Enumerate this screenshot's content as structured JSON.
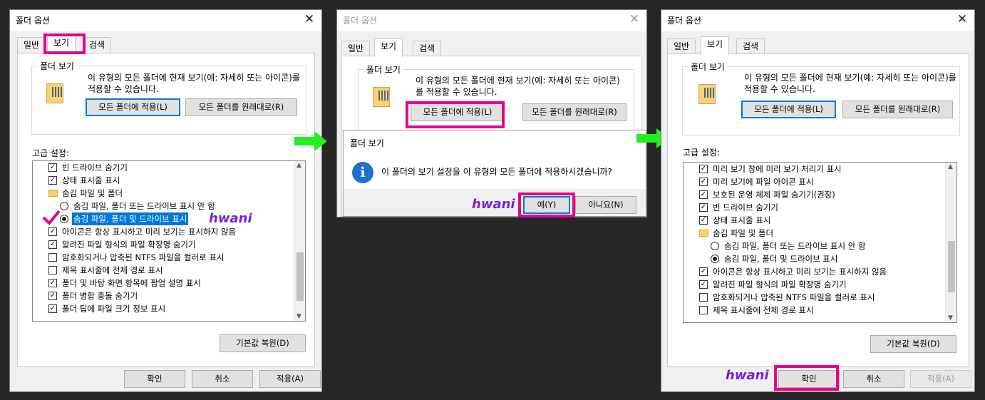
{
  "watermark": "hwani",
  "d1": {
    "title": "폴더 옵션",
    "tabs": [
      "일반",
      "보기",
      "검색"
    ],
    "group_label": "폴더 보기",
    "group_text": "이 유형의 모든 폴더에 현재 보기(예: 자세히 또는 아이콘)를 적용할 수 있습니다.",
    "apply_all": "모든 폴더에 적용(L)",
    "reset_all": "모든 폴더를 원래대로(R)",
    "adv_label": "고급 설정:",
    "items": [
      {
        "type": "check",
        "checked": true,
        "label": "빈 드라이브 숨기기",
        "indent": 0
      },
      {
        "type": "check",
        "checked": true,
        "label": "상태 표시줄 표시",
        "indent": 0
      },
      {
        "type": "folder",
        "label": "숨김 파일 및 폴더",
        "indent": 0
      },
      {
        "type": "radio",
        "checked": false,
        "label": "숨김 파일, 폴더 또는 드라이브 표시 안 함",
        "indent": 1
      },
      {
        "type": "radio",
        "checked": true,
        "label": "숨김 파일, 폴더 및 드라이브 표시",
        "indent": 1,
        "selected": true
      },
      {
        "type": "check",
        "checked": true,
        "label": "아이콘은 항상 표시하고 미리 보기는 표시하지 않음",
        "indent": 0
      },
      {
        "type": "check",
        "checked": true,
        "label": "알려진 파일 형식의 파일 확장명 숨기기",
        "indent": 0
      },
      {
        "type": "check",
        "checked": false,
        "label": "암호화되거나 압축된 NTFS 파일을 컬러로 표시",
        "indent": 0
      },
      {
        "type": "check",
        "checked": false,
        "label": "제목 표시줄에 전체 경로 표시",
        "indent": 0
      },
      {
        "type": "check",
        "checked": true,
        "label": "폴더 및 바탕 화면 항목에 팝업 설명 표시",
        "indent": 0
      },
      {
        "type": "check",
        "checked": true,
        "label": "폴더 병합 충돌 숨기기",
        "indent": 0
      },
      {
        "type": "check",
        "checked": true,
        "label": "폴더 팁에 파일 크기 정보 표시",
        "indent": 0
      }
    ],
    "restore": "기본값 복원(D)",
    "ok": "확인",
    "cancel": "취소",
    "apply": "적용(A)"
  },
  "d2": {
    "title": "폴더 옵션",
    "tabs": [
      "일반",
      "보기",
      "검색"
    ],
    "group_label": "폴더 보기",
    "group_text": "이 유형의 모든 폴더에 현재 보기(예: 자세히 또는 아이콘)를 적용할 수 있습니다.",
    "apply_all": "모든 폴더에 적용(L)",
    "reset_all": "모든 폴더를 원래대로(R)",
    "msg_title": "폴더 보기",
    "msg_text": "이 폴더의 보기 설정을 이 유형의 모든 폴더에 적용하시겠습니까?",
    "yes": "예(Y)",
    "no": "아니요(N)"
  },
  "d3": {
    "title": "폴더 옵션",
    "tabs": [
      "일반",
      "보기",
      "검색"
    ],
    "group_label": "폴더 보기",
    "group_text": "이 유형의 모든 폴더에 현재 보기(예: 자세히 또는 아이콘)를 적용할 수 있습니다.",
    "apply_all": "모든 폴더에 적용(L)",
    "reset_all": "모든 폴더를 원래대로(R)",
    "adv_label": "고급 설정:",
    "items": [
      {
        "type": "check",
        "checked": true,
        "label": "미리 보기 창에 미리 보기 처리기 표시",
        "indent": 0
      },
      {
        "type": "check",
        "checked": true,
        "label": "미리 보기에 파일 아이콘 표시",
        "indent": 0
      },
      {
        "type": "check",
        "checked": true,
        "label": "보호된 운영 체제 파일 숨기기(권장)",
        "indent": 0
      },
      {
        "type": "check",
        "checked": true,
        "label": "빈 드라이브 숨기기",
        "indent": 0
      },
      {
        "type": "check",
        "checked": true,
        "label": "상태 표시줄 표시",
        "indent": 0
      },
      {
        "type": "folder",
        "label": "숨김 파일 및 폴더",
        "indent": 0
      },
      {
        "type": "radio",
        "checked": false,
        "label": "숨김 파일, 폴더 또는 드라이브 표시 안 함",
        "indent": 1
      },
      {
        "type": "radio",
        "checked": true,
        "label": "숨김 파일, 폴더 및 드라이브 표시",
        "indent": 1
      },
      {
        "type": "check",
        "checked": true,
        "label": "아이콘은 항상 표시하고 미리 보기는 표시하지 않음",
        "indent": 0
      },
      {
        "type": "check",
        "checked": true,
        "label": "알려진 파일 형식의 파일 확장명 숨기기",
        "indent": 0
      },
      {
        "type": "check",
        "checked": false,
        "label": "암호화되거나 압축된 NTFS 파일을 컬러로 표시",
        "indent": 0
      },
      {
        "type": "check",
        "checked": false,
        "label": "제목 표시줄에 전체 경로 표시",
        "indent": 0
      }
    ],
    "restore": "기본값 복원(D)",
    "ok": "확인",
    "cancel": "취소",
    "apply": "적용(A)"
  }
}
